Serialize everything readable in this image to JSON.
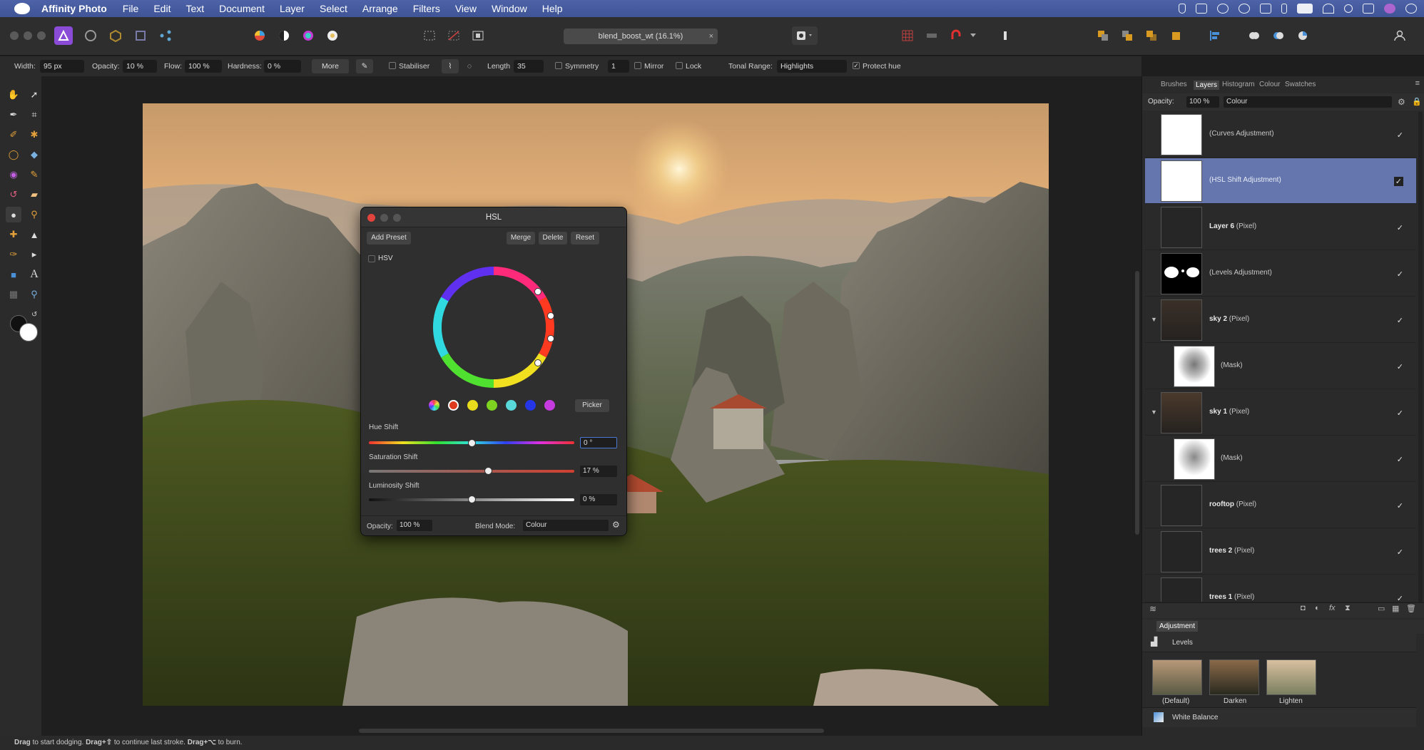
{
  "menubar": {
    "app_name": "Affinity Photo",
    "items": [
      "File",
      "Edit",
      "Text",
      "Document",
      "Layer",
      "Select",
      "Arrange",
      "Filters",
      "View",
      "Window",
      "Help"
    ]
  },
  "toolbar": {
    "document_tab": "blend_boost_wt (16.1%)",
    "document_tab_close": "×"
  },
  "context_toolbar": {
    "width_label": "Width:",
    "width_value": "95 px",
    "opacity_label": "Opacity:",
    "opacity_value": "10 %",
    "flow_label": "Flow:",
    "flow_value": "100 %",
    "hardness_label": "Hardness:",
    "hardness_value": "0 %",
    "more_label": "More",
    "stabiliser_label": "Stabiliser",
    "length_label": "Length",
    "length_value": "35",
    "symmetry_label": "Symmetry",
    "symmetry_value": "1",
    "mirror_label": "Mirror",
    "lock_label": "Lock",
    "tonal_range_label": "Tonal Range:",
    "tonal_range_value": "Highlights",
    "protect_hue_label": "Protect hue"
  },
  "hsl_dialog": {
    "title": "HSL",
    "add_preset": "Add Preset",
    "merge": "Merge",
    "delete": "Delete",
    "reset": "Reset",
    "hsv_label": "HSV",
    "picker": "Picker",
    "hue_shift_label": "Hue Shift",
    "hue_shift_value": "0 °",
    "saturation_shift_label": "Saturation Shift",
    "saturation_shift_value": "17 %",
    "luminosity_shift_label": "Luminosity Shift",
    "luminosity_shift_value": "0 %",
    "opacity_label": "Opacity:",
    "opacity_value": "100 %",
    "blend_mode_label": "Blend Mode:",
    "blend_mode_value": "Colour",
    "hue_shift_level": 0.5,
    "saturation_shift_level": 0.58,
    "luminosity_shift_level": 0.5,
    "swatch_colors": [
      "#e03a1e",
      "#e8dc1c",
      "#7ed321",
      "#58d8d8",
      "#2436e6",
      "#c63be0"
    ]
  },
  "right_panel": {
    "tabs": [
      "Brushes",
      "Layers",
      "Histogram",
      "Colour",
      "Swatches"
    ],
    "opacity_label": "Opacity:",
    "opacity_value": "100 %",
    "blend_value": "Colour",
    "layers": [
      {
        "name": "(Curves Adjustment)",
        "bold": "",
        "check": "✓"
      },
      {
        "name": "(HSL Shift Adjustment)",
        "bold": "",
        "check": "✓"
      },
      {
        "name": " (Pixel)",
        "bold": "Layer 6",
        "check": "✓"
      },
      {
        "name": "(Levels Adjustment)",
        "bold": "",
        "check": "✓"
      },
      {
        "name": " (Pixel)",
        "bold": "sky 2",
        "check": "✓"
      },
      {
        "name": "(Mask)",
        "bold": "",
        "check": "✓"
      },
      {
        "name": " (Pixel)",
        "bold": "sky 1",
        "check": "✓"
      },
      {
        "name": "(Mask)",
        "bold": "",
        "check": "✓"
      },
      {
        "name": " (Pixel)",
        "bold": "rooftop",
        "check": "✓"
      },
      {
        "name": " (Pixel)",
        "bold": "trees 2",
        "check": "✓"
      },
      {
        "name": " (Pixel)",
        "bold": "trees 1",
        "check": "✓"
      }
    ],
    "adjustment_tab": "Adjustment",
    "levels_label": "Levels",
    "presets": [
      "(Default)",
      "Darken",
      "Lighten"
    ],
    "white_balance_label": "White Balance"
  },
  "status": {
    "drag1": "Drag",
    "t1": " to start dodging. ",
    "drag2": "Drag+⇧",
    "t2": " to continue last stroke. ",
    "drag3": "Drag+⌥",
    "t3": " to burn."
  },
  "colors": {
    "selection": "#6476ad",
    "menubar": "#4a5fa5"
  }
}
